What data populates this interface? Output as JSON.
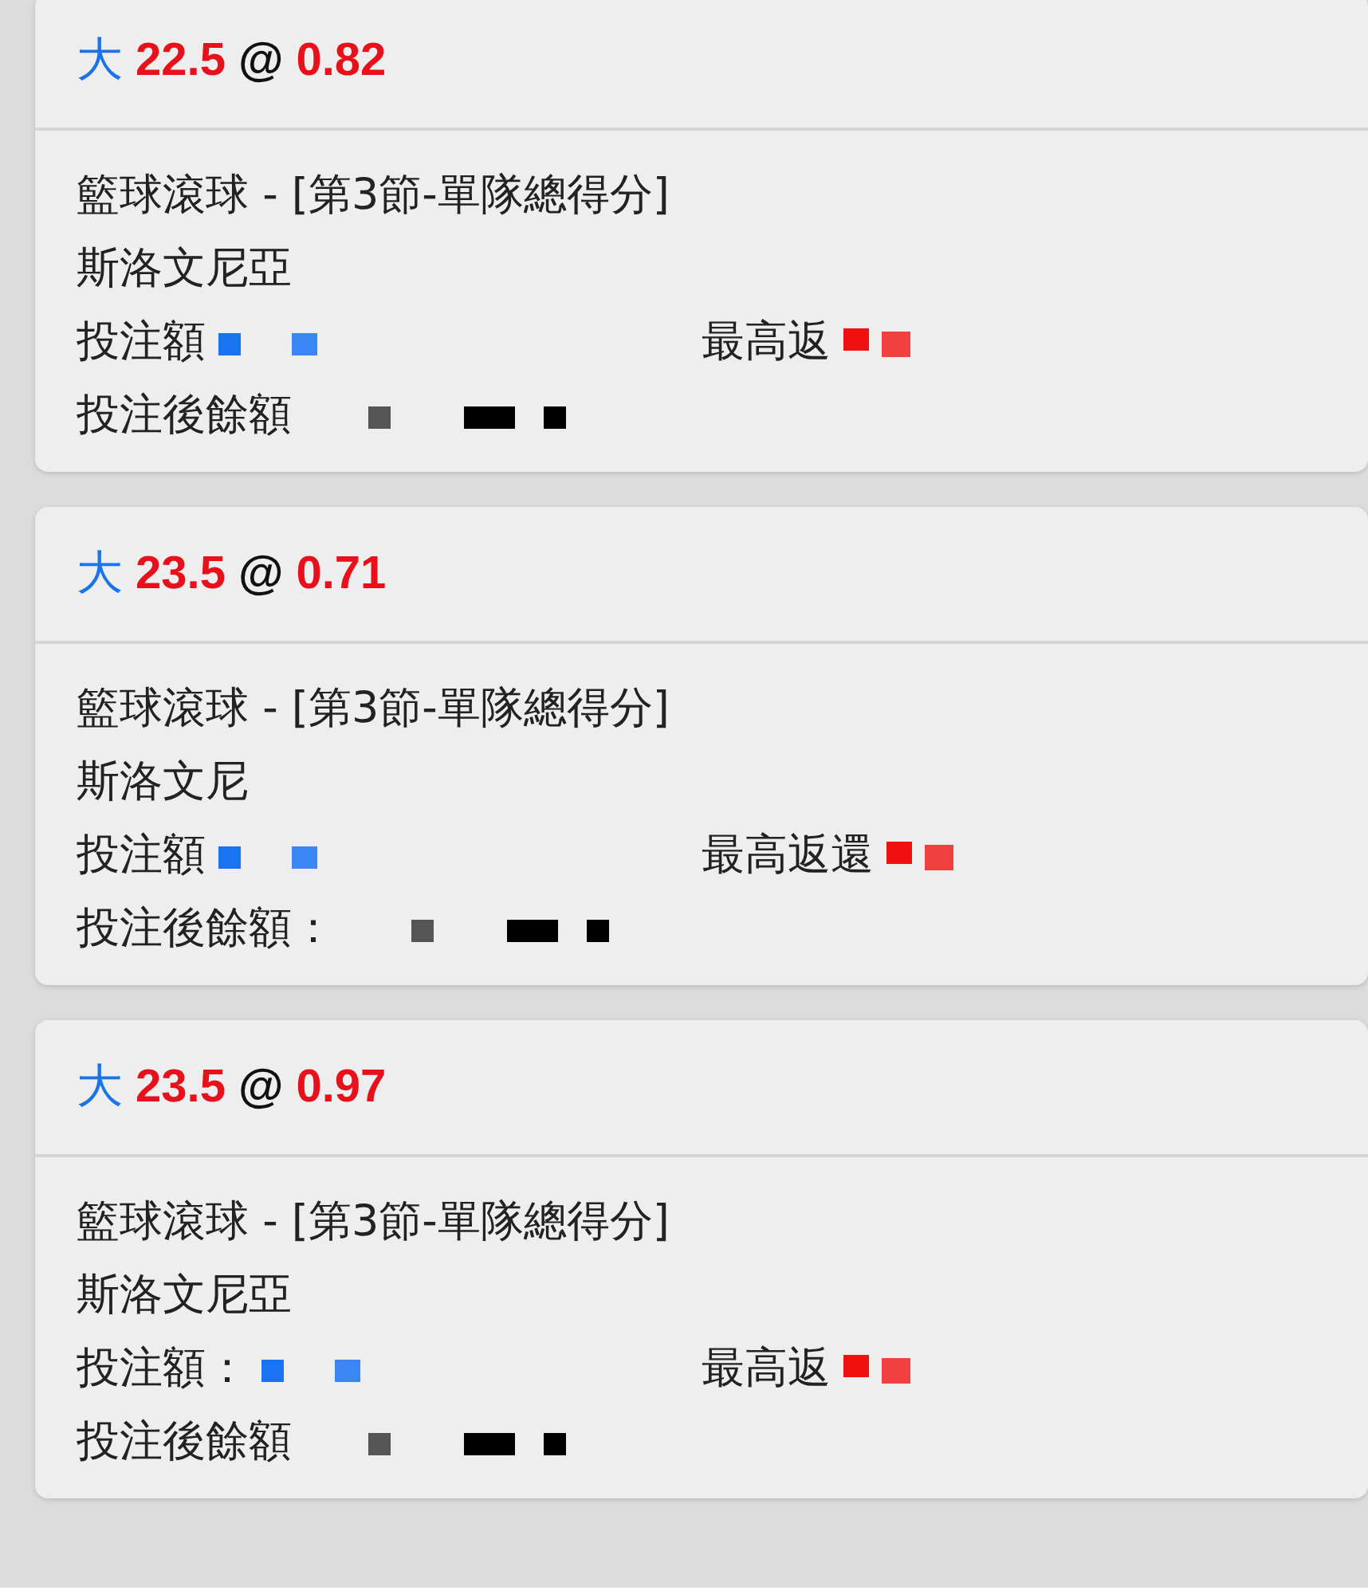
{
  "bets": [
    {
      "side": "大",
      "line": "22.5",
      "at": "@",
      "odds": "0.82",
      "market": "籃球滾球 - [第3節-單隊總得分]",
      "team": "斯洛文尼亞",
      "stake_label": "投注額",
      "return_label": "最高返",
      "balance_label": "投注後餘額"
    },
    {
      "side": "大",
      "line": "23.5",
      "at": "@",
      "odds": "0.71",
      "market": "籃球滾球 - [第3節-單隊總得分]",
      "team": "斯洛文尼",
      "stake_label": "投注額",
      "return_label": "最高返還",
      "balance_label": "投注後餘額："
    },
    {
      "side": "大",
      "line": "23.5",
      "at": "@",
      "odds": "0.97",
      "market": "籃球滾球 - [第3節-單隊總得分]",
      "team": "斯洛文尼亞",
      "stake_label": "投注額：",
      "return_label": "最高返",
      "balance_label": "投注後餘額"
    }
  ]
}
